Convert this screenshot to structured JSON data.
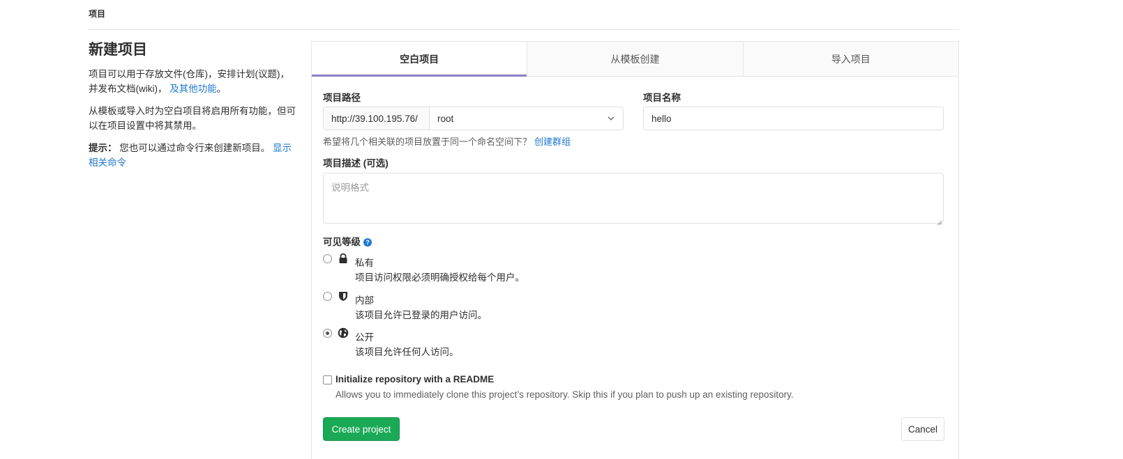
{
  "breadcrumb": "项目",
  "left": {
    "title": "新建项目",
    "para1_text": "项目可以用于存放文件(仓库)，安排计划(议题)，并发布文档(wiki)，",
    "para1_link": "及其他功能",
    "para1_end": "。",
    "para2": "从模板或导入时为空白项目将启用所有功能，但可以在项目设置中将其禁用。",
    "tip_label": "提示：",
    "tip_text": "您也可以通过命令行来创建新项目。",
    "tip_link": "显示相关命令"
  },
  "tabs": [
    {
      "label": "空白项目",
      "active": true
    },
    {
      "label": "从模板创建",
      "active": false
    },
    {
      "label": "导入项目",
      "active": false
    }
  ],
  "form": {
    "path_label": "项目路径",
    "path_prefix": "http://39.100.195.76/",
    "namespace_value": "root",
    "name_label": "项目名称",
    "name_value": "hello",
    "help_text": "希望将几个相关联的项目放置于同一个命名空间下？",
    "help_link": "创建群组",
    "desc_label": "项目描述 (可选)",
    "desc_placeholder": "说明格式",
    "visibility_label": "可见等级",
    "visibility_options": [
      {
        "title": "私有",
        "desc": "项目访问权限必须明确授权给每个用户。",
        "icon": "lock-icon",
        "checked": false
      },
      {
        "title": "内部",
        "desc": "该项目允许已登录的用户访问。",
        "icon": "shield-icon",
        "checked": false
      },
      {
        "title": "公开",
        "desc": "该项目允许任何人访问。",
        "icon": "globe-icon",
        "checked": true
      }
    ],
    "readme_label": "Initialize repository with a README",
    "readme_help": "Allows you to immediately clone this project’s repository. Skip this if you plan to push up an existing repository.",
    "readme_checked": false,
    "create_label": "Create project",
    "cancel_label": "Cancel"
  },
  "colors": {
    "accent_tab": "#8b7fc4",
    "link": "#1f78d1",
    "create_button": "#1aaa55"
  }
}
